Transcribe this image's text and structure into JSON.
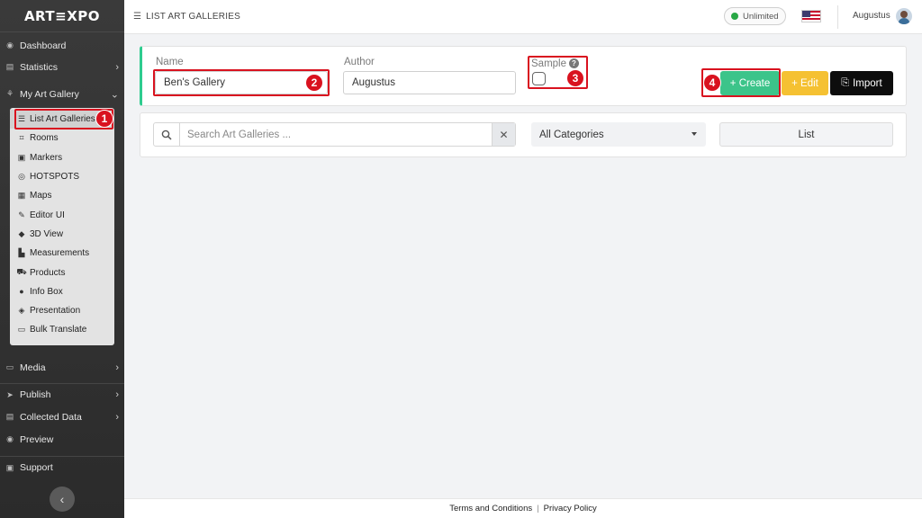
{
  "app": {
    "logo": "ART≡XPO"
  },
  "sidebar": {
    "items": [
      {
        "label": "Dashboard",
        "icon": "dashboard-icon"
      },
      {
        "label": "Statistics",
        "icon": "statistics-icon"
      },
      {
        "label": "My Art Gallery",
        "icon": "gallery-icon"
      },
      {
        "label": "Media",
        "icon": "monitor-icon"
      },
      {
        "label": "Publish",
        "icon": "send-icon"
      },
      {
        "label": "Collected Data",
        "icon": "database-icon"
      },
      {
        "label": "Preview",
        "icon": "eye-icon"
      },
      {
        "label": "Support",
        "icon": "support-icon"
      }
    ],
    "submenu": [
      {
        "label": "List Art Galleries",
        "icon": "list-icon"
      },
      {
        "label": "Rooms",
        "icon": "rooms-icon"
      },
      {
        "label": "Markers",
        "icon": "marker-icon"
      },
      {
        "label": "HOTSPOTS",
        "icon": "hotspot-icon"
      },
      {
        "label": "Maps",
        "icon": "map-icon"
      },
      {
        "label": "Editor UI",
        "icon": "editor-ui-icon"
      },
      {
        "label": "3D View",
        "icon": "cube-icon"
      },
      {
        "label": "Measurements",
        "icon": "measurement-icon"
      },
      {
        "label": "Products",
        "icon": "cart-icon"
      },
      {
        "label": "Info Box",
        "icon": "info-icon"
      },
      {
        "label": "Presentation",
        "icon": "presentation-icon"
      },
      {
        "label": "Bulk Translate",
        "icon": "translate-icon"
      }
    ]
  },
  "header": {
    "title": "LIST ART GALLERIES",
    "plan": "Unlimited",
    "username": "Augustus",
    "language_flag": "us-flag-icon"
  },
  "form": {
    "name_label": "Name",
    "name_value": "Ben's Gallery",
    "author_label": "Author",
    "author_value": "Augustus",
    "sample_label": "Sample",
    "create_label": "+ Create",
    "edit_label": "+ Edit",
    "import_label": "Import"
  },
  "filter": {
    "search_placeholder": "Search Art Galleries ...",
    "category_selected": "All Categories",
    "list_label": "List"
  },
  "footer": {
    "terms": "Terms and Conditions",
    "separator": "|",
    "privacy": "Privacy Policy"
  },
  "annotations": [
    "1",
    "2",
    "3",
    "4"
  ],
  "colors": {
    "accent_green": "#3cc48a",
    "edit_yellow": "#f5c132",
    "import_black": "#0d0d0d",
    "annotation_red": "#d9121f"
  }
}
